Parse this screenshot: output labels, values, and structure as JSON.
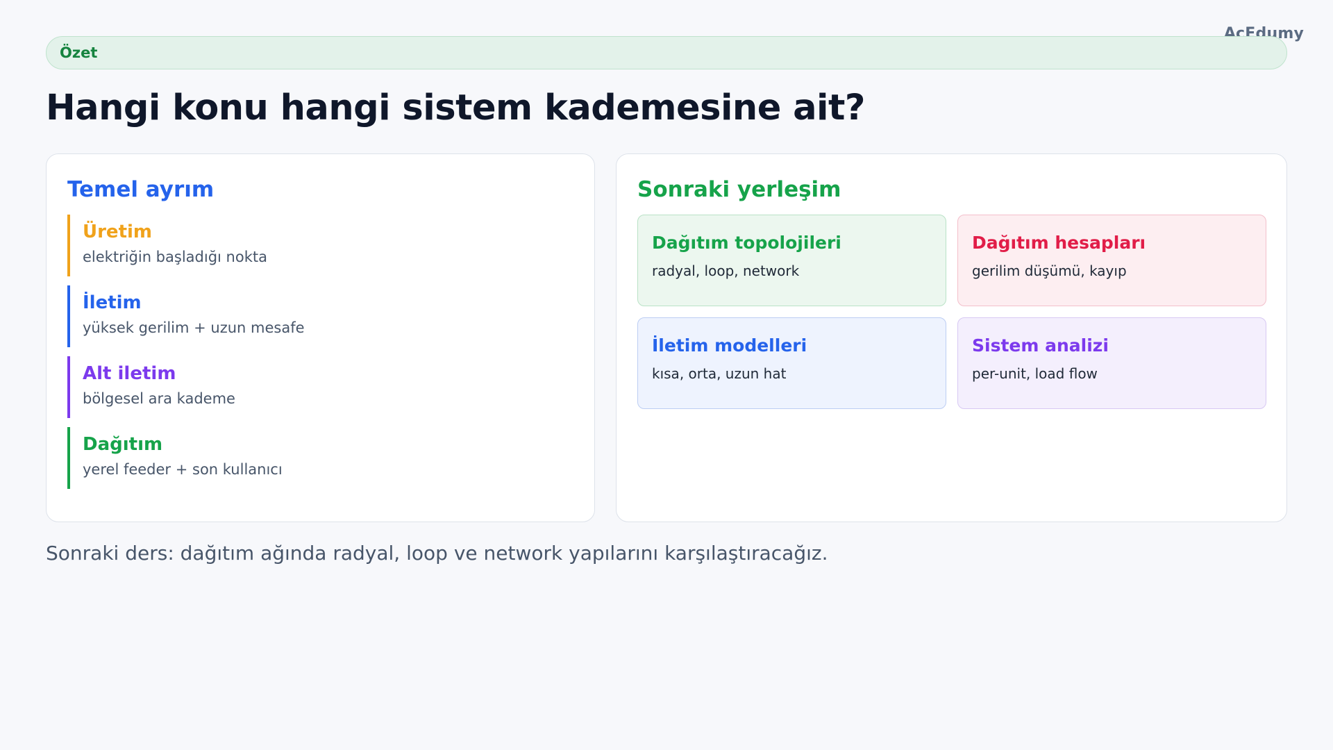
{
  "brand": "AcEdumy",
  "badge": "Özet",
  "title": "Hangi konu hangi sistem kademesine ait?",
  "left_card": {
    "title": "Temel ayrım",
    "stages": [
      {
        "name": "Üretim",
        "desc": "elektriğin başladığı nokta",
        "color": "#f0a21b"
      },
      {
        "name": "İletim",
        "desc": "yüksek gerilim + uzun mesafe",
        "color": "#2563eb"
      },
      {
        "name": "Alt iletim",
        "desc": "bölgesel ara kademe",
        "color": "#7c3aed"
      },
      {
        "name": "Dağıtım",
        "desc": "yerel feeder + son kullanıcı",
        "color": "#16a34a"
      }
    ]
  },
  "right_card": {
    "title": "Sonraki yerleşim",
    "tiles": [
      {
        "title": "Dağıtım topolojileri",
        "desc": "radyal, loop, network",
        "color": "#16a34a",
        "bg": "#ecf7ef",
        "border": "#b9e2c6"
      },
      {
        "title": "Dağıtım hesapları",
        "desc": "gerilim düşümü, kayıp",
        "color": "#e11d48",
        "bg": "#fdeef1",
        "border": "#f3bfcb"
      },
      {
        "title": "İletim modelleri",
        "desc": "kısa, orta, uzun hat",
        "color": "#2563eb",
        "bg": "#eef3fe",
        "border": "#bccdf3"
      },
      {
        "title": "Sistem analizi",
        "desc": "per-unit, load flow",
        "color": "#7c3aed",
        "bg": "#f4effd",
        "border": "#d7c8f3"
      }
    ]
  },
  "footer": "Sonraki ders: dağıtım ağında radyal, loop ve network yapılarını karşılaştıracağız."
}
